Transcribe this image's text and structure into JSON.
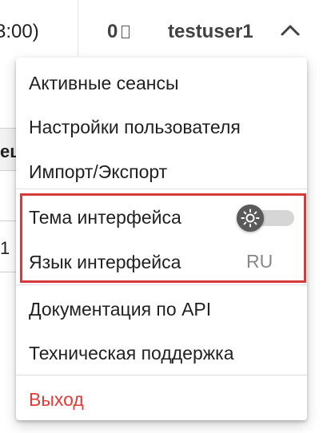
{
  "topbar": {
    "time_fragment": "3:00)",
    "counter_value": "0",
    "username": "testuser1",
    "chevron_icon": "chevron-up-icon"
  },
  "background": {
    "header_fragment": "ец",
    "cell_fragment": "1"
  },
  "menu": {
    "items": [
      {
        "label": "Активные сеансы"
      },
      {
        "label": "Настройки пользователя"
      },
      {
        "label": "Импорт/Экспорт"
      },
      {
        "label": "Тема интерфейса"
      },
      {
        "label": "Язык интерфейса"
      },
      {
        "label": "Документация по API"
      },
      {
        "label": "Техническая поддержка"
      },
      {
        "label": "Выход"
      }
    ],
    "theme_toggle": {
      "icon": "sun-icon",
      "enabled": false
    },
    "language_value": "RU"
  },
  "colors": {
    "highlight_border": "#d63a3a",
    "logout_text": "#e53935",
    "toggle_thumb": "#5a5a5a",
    "toggle_track": "#d6d6d6"
  }
}
